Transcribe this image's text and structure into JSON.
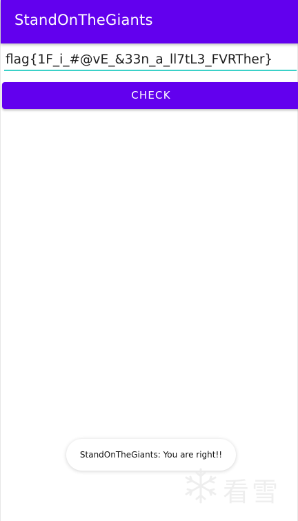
{
  "app_bar": {
    "title": "StandOnTheGiants"
  },
  "flag_input": {
    "value": "flag{1F_i_#@vE_&33n_a_ll7tL3_FVRTher}"
  },
  "check_button": {
    "label": "CHECK"
  },
  "toast": {
    "message": "StandOnTheGiants: You are right!!"
  },
  "watermark": {
    "text": "看雪",
    "icon": "snowflake-icon"
  },
  "colors": {
    "primary": "#6200ee",
    "accent": "#3ad1c8",
    "background": "#ffffff"
  }
}
